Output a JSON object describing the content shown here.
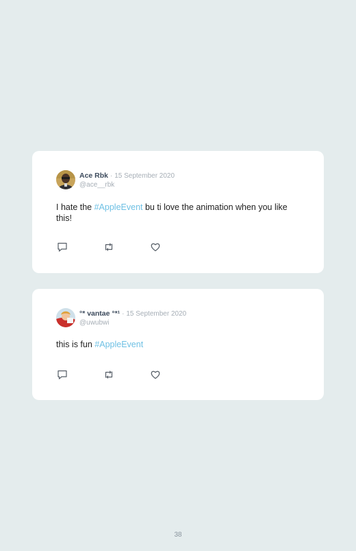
{
  "tweets": [
    {
      "author": "Ace Rbk",
      "separator": "·",
      "date": "15 September 2020",
      "handle": "@ace__rbk",
      "text_before": "I hate the ",
      "hashtag": "#AppleEvent",
      "text_after": " bu ti love the animation when you like this!"
    },
    {
      "author": "°* vantae °*¹",
      "separator": "·",
      "date": "15 September 2020",
      "handle": "@uwubwi",
      "text_before": "this is fun ",
      "hashtag": "#AppleEvent",
      "text_after": ""
    }
  ],
  "actions": [
    "reply-icon",
    "retweet-icon",
    "like-icon"
  ],
  "page_number": "38",
  "colors": {
    "background": "#e4eced",
    "card": "#ffffff",
    "hashtag": "#6ec0e4",
    "muted": "#a6aeb6",
    "name": "#3c4a5c"
  }
}
